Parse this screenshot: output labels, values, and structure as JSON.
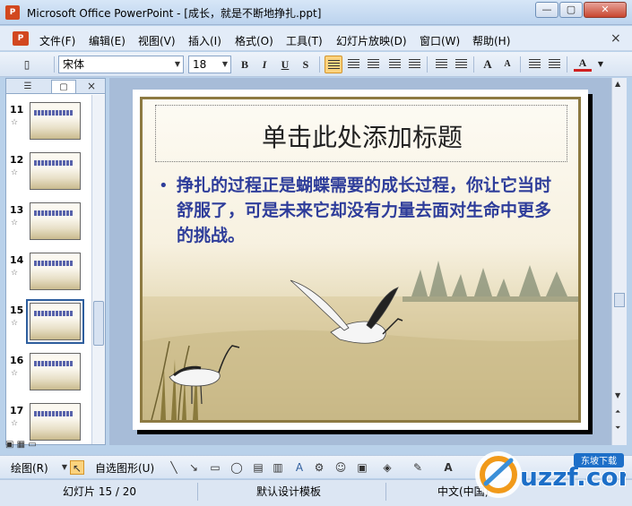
{
  "window": {
    "title": "Microsoft Office PowerPoint - [成长，就是不断地挣扎.ppt]",
    "app_icon": "powerpoint-icon",
    "controls": [
      "minimize",
      "maximize",
      "close"
    ]
  },
  "menu": {
    "items": [
      "文件(F)",
      "编辑(E)",
      "视图(V)",
      "插入(I)",
      "格式(O)",
      "工具(T)",
      "幻灯片放映(D)",
      "窗口(W)",
      "帮助(H)"
    ],
    "close_label": "×"
  },
  "toolbar": {
    "font_name": "宋体",
    "font_size": "18",
    "bold": "B",
    "italic": "I",
    "underline": "U",
    "shadow": "S",
    "increase_font": "A",
    "decrease_font": "A",
    "font_color": "A",
    "active_alignment": "align-left"
  },
  "left_pane": {
    "tabs": [
      "outline",
      "slides"
    ],
    "active_tab": "slides",
    "close_label": "×",
    "slides": [
      {
        "number": "11",
        "star": "☆"
      },
      {
        "number": "12",
        "star": "☆"
      },
      {
        "number": "13",
        "star": "☆"
      },
      {
        "number": "14",
        "star": "☆"
      },
      {
        "number": "15",
        "star": "☆",
        "selected": true
      },
      {
        "number": "16",
        "star": "☆"
      },
      {
        "number": "17",
        "star": "☆"
      }
    ]
  },
  "slide": {
    "title": "单击此处添加标题",
    "bullet": "•",
    "body": "挣扎的过程正是蝴蝶需要的成长过程，你让它当时舒服了，可是未来它却没有力量去面对生命中更多的挑战。"
  },
  "drawing_toolbar": {
    "draw_label": "绘图(R)",
    "autoshapes_label": "自选图形(U)"
  },
  "status": {
    "slide_indicator": "幻灯片 15 / 20",
    "design_template": "默认设计模板",
    "language": "中文(中国)"
  },
  "watermark": {
    "text": "uzzf.com",
    "subtext": "东坡下载"
  },
  "colors": {
    "accent": "#2e3d9a",
    "frame": "#8d7a42",
    "ui_blue": "#b9d1ea"
  }
}
